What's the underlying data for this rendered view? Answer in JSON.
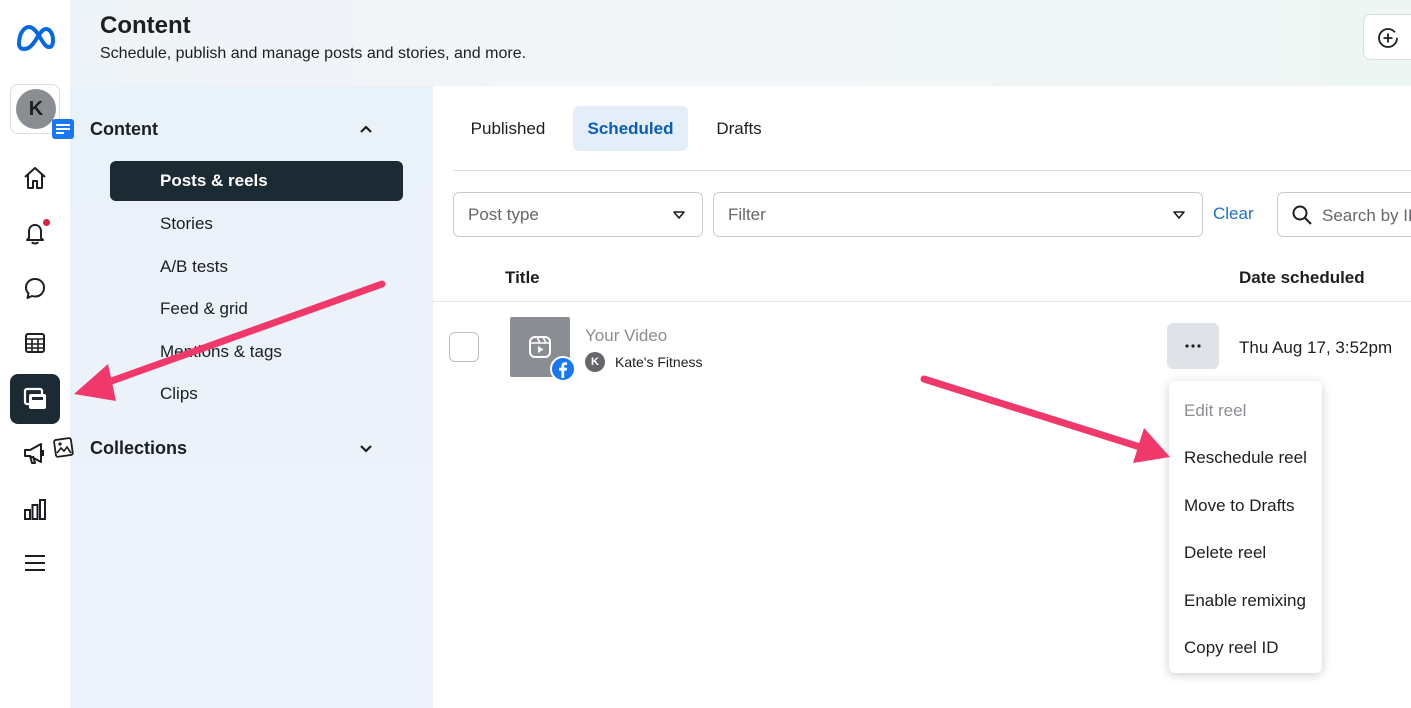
{
  "header": {
    "title": "Content",
    "subtitle": "Schedule, publish and manage posts and stories, and more."
  },
  "rail": {
    "account_initial": "K",
    "items": [
      "home-icon",
      "notifications-icon",
      "inbox-icon",
      "planner-icon",
      "content-icon",
      "ads-icon",
      "insights-icon",
      "menu-icon"
    ],
    "active": "content-icon"
  },
  "sidebar": {
    "content_section": "Content",
    "items": [
      "Posts & reels",
      "Stories",
      "A/B tests",
      "Feed & grid",
      "Mentions & tags",
      "Clips"
    ],
    "active_item": "Posts & reels",
    "collections_section": "Collections"
  },
  "tabs": {
    "published": "Published",
    "scheduled": "Scheduled",
    "drafts": "Drafts",
    "active": "Scheduled"
  },
  "filters": {
    "post_type_placeholder": "Post type",
    "filter_placeholder": "Filter",
    "clear_label": "Clear",
    "search_placeholder": "Search by ID"
  },
  "table": {
    "col_title": "Title",
    "col_date": "Date scheduled",
    "rows": [
      {
        "title": "Your Video",
        "account_initial": "K",
        "account": "Kate's Fitness",
        "date": "Thu Aug 17, 3:52pm"
      }
    ]
  },
  "context_menu": {
    "items": [
      "Edit reel",
      "Reschedule reel",
      "Move to Drafts",
      "Delete reel",
      "Enable remixing",
      "Copy reel ID"
    ],
    "disabled": [
      "Edit reel"
    ]
  },
  "colors": {
    "accent": "#0a5db8",
    "active_nav": "#1c2b33",
    "annotation_arrow": "#f0386b"
  }
}
